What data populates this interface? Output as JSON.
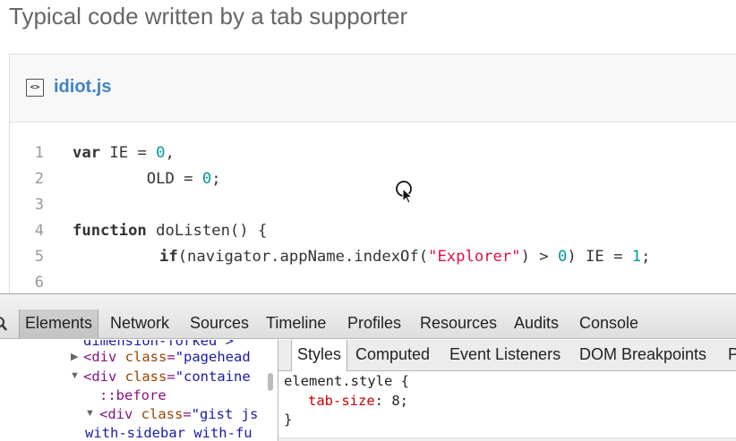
{
  "page": {
    "heading": "Typical code written by a tab supporter"
  },
  "gist": {
    "file_icon": "code-file-icon",
    "file_icon_glyph": "<>",
    "file_name": "idiot.js",
    "line_numbers": [
      "1",
      "2",
      "3",
      "4",
      "5",
      "6"
    ],
    "code": {
      "l1_kw": "var",
      "l1_a": " IE = ",
      "l1_num": "0",
      "l1_b": ",",
      "l2_a": "        OLD = ",
      "l2_num": "0",
      "l2_b": ";",
      "l4_kw": "function",
      "l4_a": " doListen() {",
      "l5_kw": "if",
      "l5_a": "(navigator.appName.indexOf(",
      "l5_str": "\"Explorer\"",
      "l5_b": ") > ",
      "l5_num1": "0",
      "l5_c": ") IE = ",
      "l5_num2": "1",
      "l5_d": ";"
    },
    "colors": {
      "link": "#4183c4",
      "number": "#009999",
      "string": "#dd1144"
    }
  },
  "devtools": {
    "toolbar_tabs": [
      "Elements",
      "Network",
      "Sources",
      "Timeline",
      "Profiles",
      "Resources",
      "Audits",
      "Console"
    ],
    "active_tab": "Elements",
    "dom": {
      "l0": "dimension-forked\">",
      "l1_tag": "<div ",
      "l1_attr": "class",
      "l1_eq": "=",
      "l1_val": "\"pagehead",
      "l2_tag": "<div ",
      "l2_attr": "class",
      "l2_eq": "=",
      "l2_val": "\"containe",
      "l3": "::before",
      "l4_tag": "<div ",
      "l4_attr": "class",
      "l4_eq": "=",
      "l4_val": "\"gist js",
      "l5_val": "with-sidebar with-fu"
    },
    "sidebar_tabs": [
      "Styles",
      "Computed",
      "Event Listeners",
      "DOM Breakpoints",
      "P"
    ],
    "active_sidebar_tab": "Styles",
    "styles": {
      "selector": "element.style {",
      "prop": "tab-size",
      "colon": ": ",
      "value": "8",
      "semicolon": ";",
      "close": "}"
    }
  }
}
